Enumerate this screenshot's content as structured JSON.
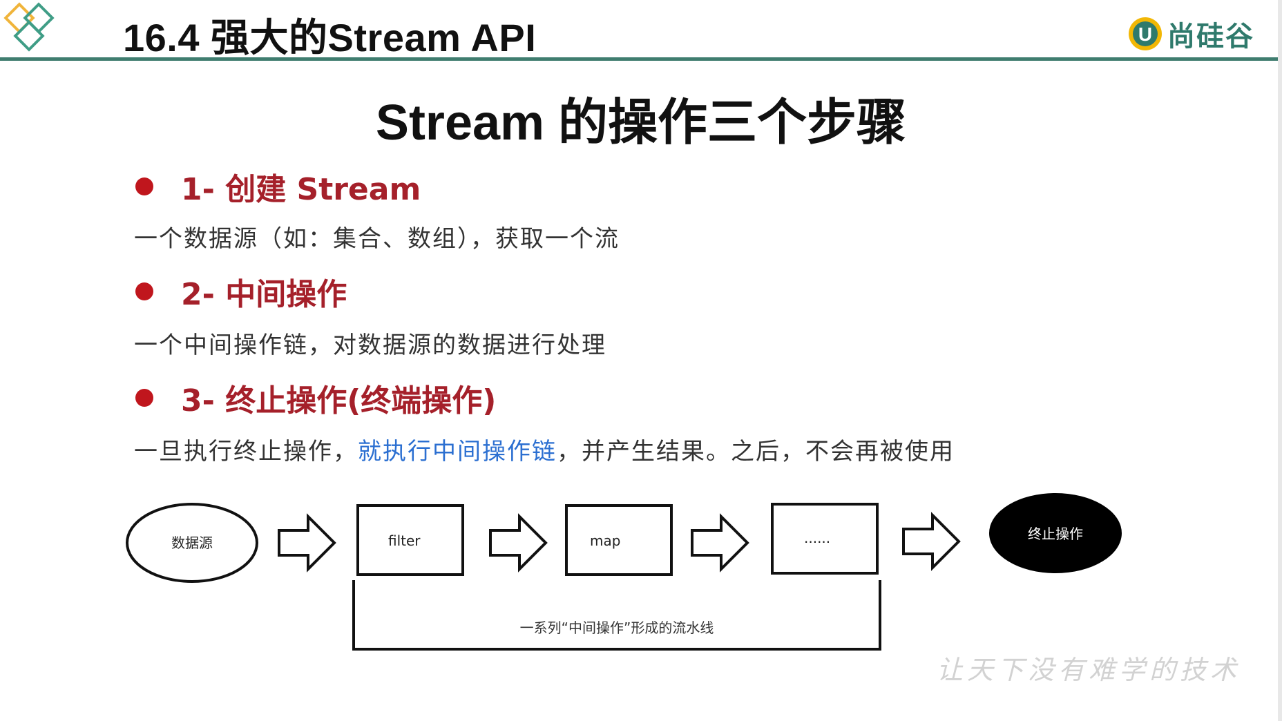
{
  "header": {
    "title": "16.4 强大的Stream API",
    "brand": "尚硅谷",
    "brand_mark": "U"
  },
  "slide": {
    "title": "Stream 的操作三个步骤",
    "steps": [
      {
        "heading": "1- 创建 Stream",
        "description": "一个数据源（如：集合、数组），获取一个流"
      },
      {
        "heading": "2- 中间操作",
        "description": "一个中间操作链，对数据源的数据进行处理"
      },
      {
        "heading": "3- 终止操作(终端操作)",
        "description_before": "一旦执行终止操作，",
        "description_highlight": "就执行中间操作链",
        "description_after": "，并产生结果。之后，不会再被使用"
      }
    ]
  },
  "diagram": {
    "source": "数据源",
    "ops": [
      "filter",
      "map",
      "......"
    ],
    "terminal": "终止操作",
    "pipeline_label": "一系列“中间操作”形成的流水线"
  },
  "watermark": "让天下没有难学的技术",
  "colors": {
    "accent_teal": "#3f7d6f",
    "heading_red": "#a5202a",
    "bullet_red": "#c0161d",
    "highlight_blue": "#2b6fd1",
    "brand_green": "#2f7a6c"
  }
}
